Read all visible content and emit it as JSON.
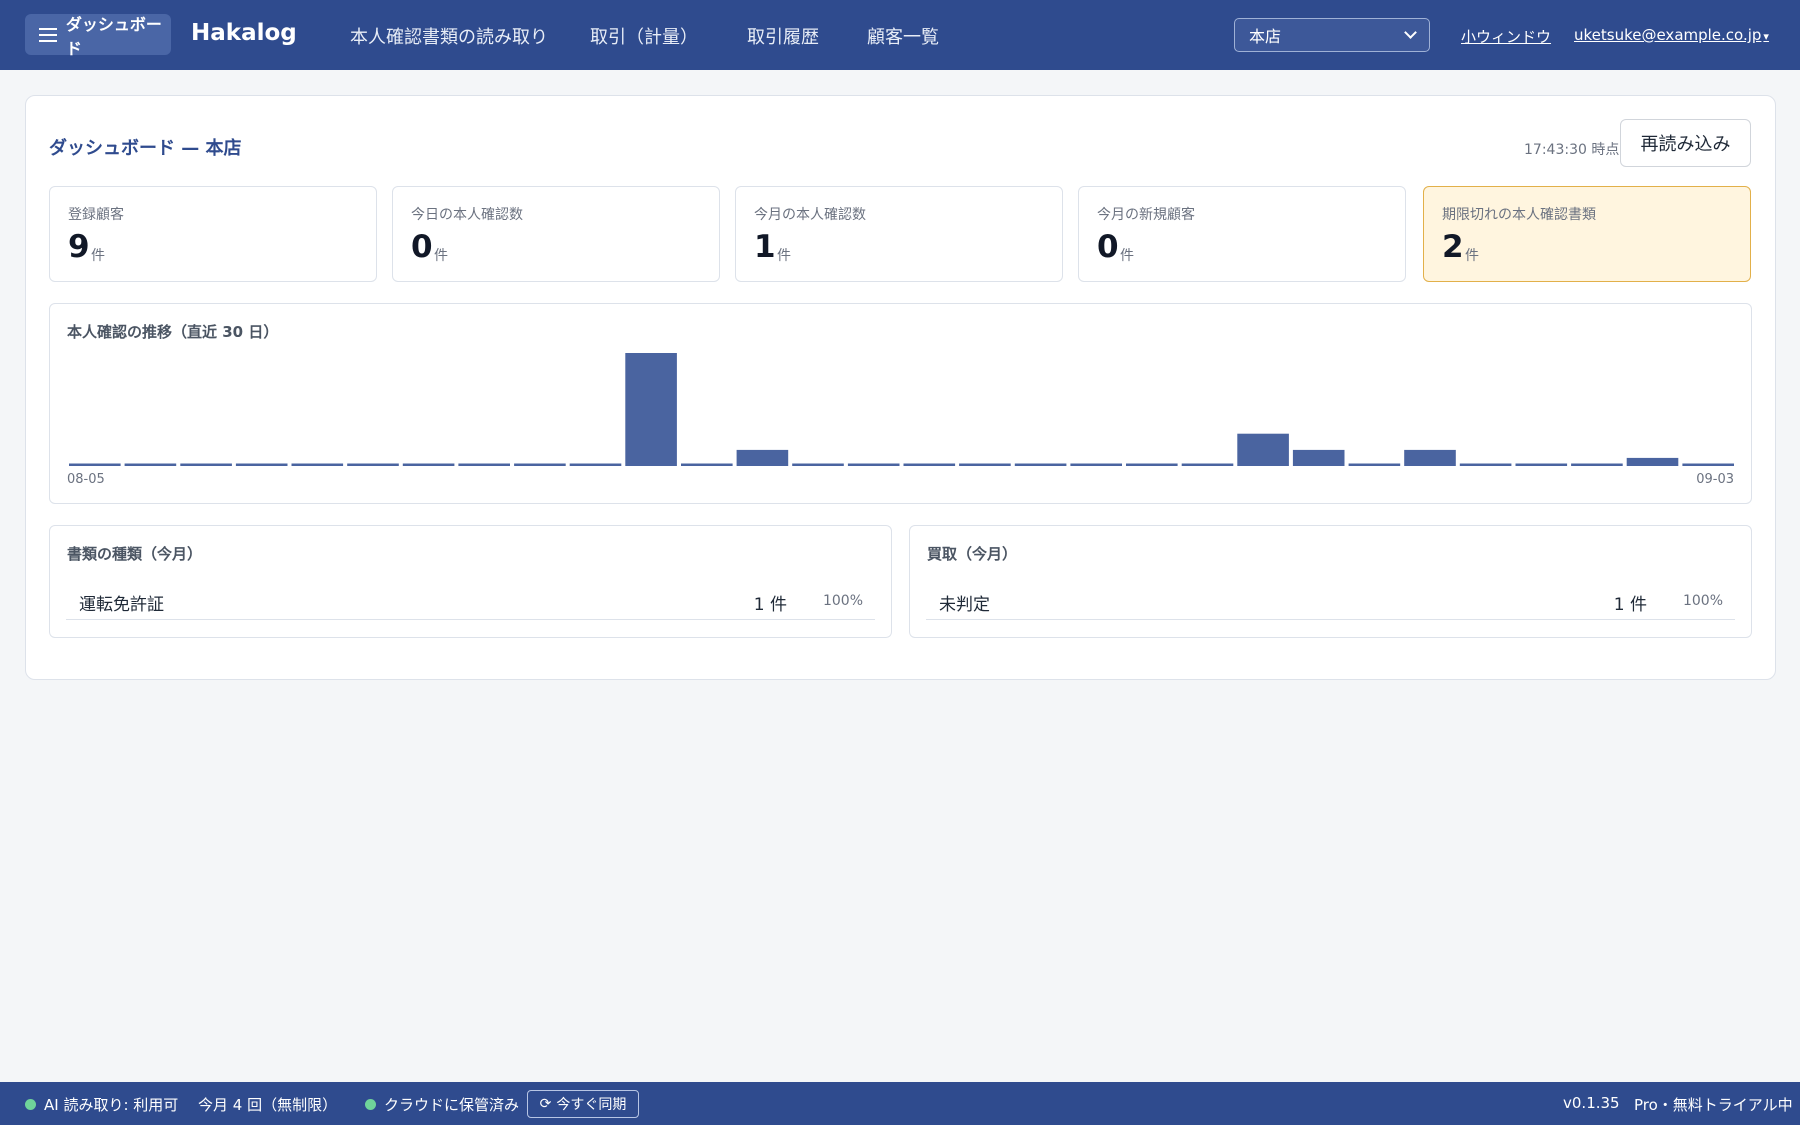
{
  "header": {
    "dashboard_label": "ダッシュボード",
    "brand": "Hakalog",
    "nav": [
      {
        "label": "本人確認書類の読み取り"
      },
      {
        "label": "取引（計量）"
      },
      {
        "label": "取引履歴"
      },
      {
        "label": "顧客一覧"
      }
    ],
    "store_selected": "本店",
    "mini_window_label": "小ウィンドウ",
    "user_email": "uketsuke@example.co.jp",
    "user_caret": "▾"
  },
  "main": {
    "title": "ダッシュボード — 本店",
    "as_of": "17:43:30 時点",
    "reload_label": "再読み込み",
    "stats": [
      {
        "label": "登録顧客",
        "value": "9",
        "unit": "件"
      },
      {
        "label": "今日の本人確認数",
        "value": "0",
        "unit": "件"
      },
      {
        "label": "今月の本人確認数",
        "value": "1",
        "unit": "件"
      },
      {
        "label": "今月の新規顧客",
        "value": "0",
        "unit": "件"
      },
      {
        "label": "期限切れの本人確認書類",
        "value": "2",
        "unit": "件"
      }
    ],
    "trend_title": "本人確認の推移（直近 30 日）",
    "doc_types_title": "書類の種類（今月）",
    "doc_types": [
      {
        "name": "運転免許証",
        "count": "1 件",
        "pct": "100%"
      }
    ],
    "purchase_title": "買取（今月）",
    "purchase": [
      {
        "name": "未判定",
        "count": "1 件",
        "pct": "100%"
      }
    ]
  },
  "chart_data": {
    "type": "bar",
    "title": "本人確認の推移（直近 30 日）",
    "x_start_label": "08-05",
    "x_end_label": "09-03",
    "values": [
      0,
      0,
      0,
      0,
      0,
      0,
      0,
      0,
      0,
      0,
      7,
      0,
      1,
      0,
      0,
      0,
      0,
      0,
      0,
      0,
      0,
      2,
      1,
      0,
      1,
      0,
      0,
      0,
      0.5,
      0
    ],
    "ylim": [
      0,
      7
    ],
    "bar_color": "#4a64a0"
  },
  "footer": {
    "ai_status": "AI 読み取り: 利用可",
    "usage": "今月 4 回（無制限）",
    "cloud_status": "クラウドに保管済み",
    "sync_label": "今すぐ同期",
    "version": "v0.1.35",
    "plan": "Pro・無料トライアル中"
  },
  "colors": {
    "primary": "#2f4b8e",
    "warn_bg": "#fff5df",
    "ok_dot": "#6fd49a"
  }
}
